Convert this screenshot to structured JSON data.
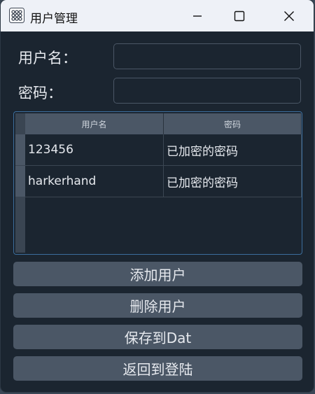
{
  "window": {
    "title": "用户管理",
    "icon": "app-grid-icon",
    "controls": [
      "minimize-icon",
      "maximize-icon",
      "close-icon"
    ]
  },
  "form": {
    "username_label": "用户名：",
    "password_label": "密码：",
    "username_value": "",
    "password_value": ""
  },
  "table": {
    "headers": [
      "用户名",
      "密码"
    ],
    "rows": [
      [
        "123456",
        "已加密的密码"
      ],
      [
        "harkerhand",
        "已加密的密码"
      ]
    ]
  },
  "buttons": {
    "add": "添加用户",
    "delete": "删除用户",
    "save": "保存到Dat",
    "back": "返回到登陆"
  },
  "colors": {
    "window_bg": "#1b2530",
    "button_bg": "#4b5766",
    "frame_accent": "#3c6e9d",
    "titlebar_bg": "#eef1f7"
  }
}
